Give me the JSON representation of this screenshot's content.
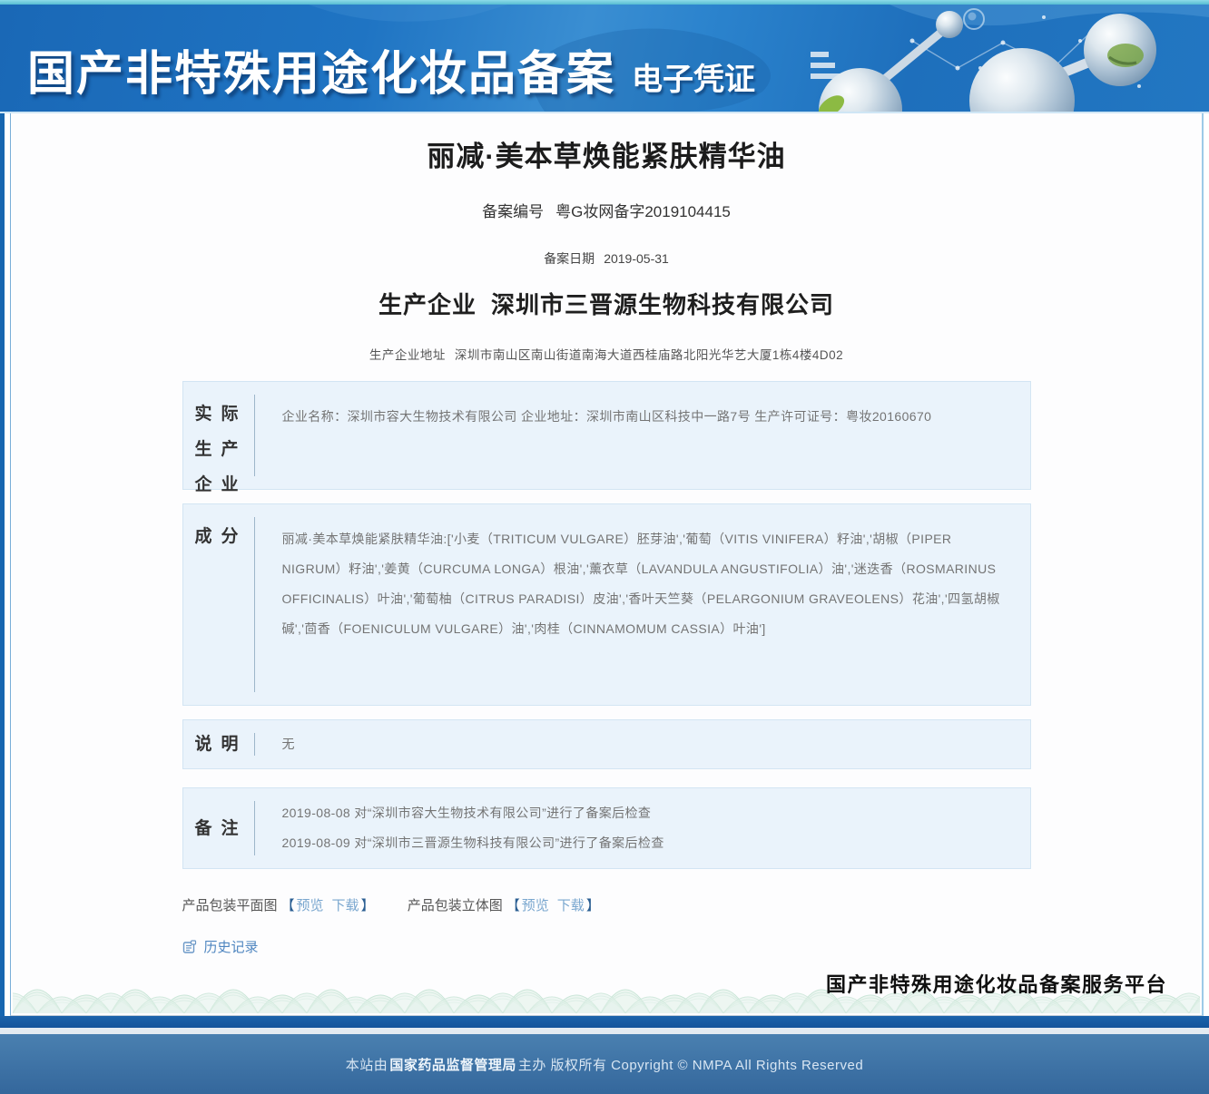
{
  "banner": {
    "title": "国产非特殊用途化妆品备案",
    "subtitle": "电子凭证"
  },
  "certificate": {
    "product_name": "丽减·美本草焕能紧肤精华油",
    "reg_no_label": "备案编号",
    "reg_no": "粤G妆网备字2019104415",
    "reg_date_label": "备案日期",
    "reg_date": "2019-05-31",
    "producer_label": "生产企业",
    "producer": "深圳市三晋源生物科技有限公司",
    "producer_address_label": "生产企业地址",
    "producer_address": "深圳市南山区南山街道南海大道西桂庙路北阳光华艺大厦1栋4楼4D02"
  },
  "sections": {
    "actual_producer": {
      "label": "实际生产企业",
      "content": "企业名称：深圳市容大生物技术有限公司 企业地址：深圳市南山区科技中一路7号 生产许可证号：粤妆20160670"
    },
    "ingredients": {
      "label": "成分",
      "content": "丽减·美本草焕能紧肤精华油:['小麦（TRITICUM VULGARE）胚芽油','葡萄（VITIS VINIFERA）籽油','胡椒（PIPER NIGRUM）籽油','姜黄（CURCUMA LONGA）根油','薰衣草（LAVANDULA ANGUSTIFOLIA）油','迷迭香（ROSMARINUS OFFICINALIS）叶油','葡萄柚（CITRUS PARADISI）皮油','香叶天竺葵（PELARGONIUM GRAVEOLENS）花油','四氢胡椒碱','茴香（FOENICULUM VULGARE）油','肉桂（CINNAMOMUM CASSIA）叶油']"
    },
    "explanation": {
      "label": "说明",
      "content": "无"
    },
    "remarks": {
      "label": "备注",
      "lines": [
        "2019-08-08 对“深圳市容大生物技术有限公司”进行了备案后检查",
        "2019-08-09 对“深圳市三晋源生物科技有限公司”进行了备案后检查"
      ]
    }
  },
  "attachments": {
    "bracket_open": "【",
    "bracket_close": "】",
    "items": [
      {
        "label": "产品包装平面图",
        "preview": "预览",
        "download": "下载"
      },
      {
        "label": "产品包装立体图",
        "preview": "预览",
        "download": "下载"
      }
    ]
  },
  "history": {
    "label": "历史记录"
  },
  "platform": {
    "name": "国产非特殊用途化妆品备案服务平台"
  },
  "footer": {
    "prefix": "本站由",
    "org": "国家药品监督管理局",
    "suffix": "主办 版权所有 Copyright © NMPA All Rights Reserved"
  },
  "colors": {
    "banner_blue": "#2176c3",
    "box_bg": "#eaf3fb",
    "link_blue": "#7aa7cf",
    "bracket_navy": "#2a5e92",
    "wave_green": "#bfe0d0",
    "footer_blue": "#3f74a7"
  }
}
